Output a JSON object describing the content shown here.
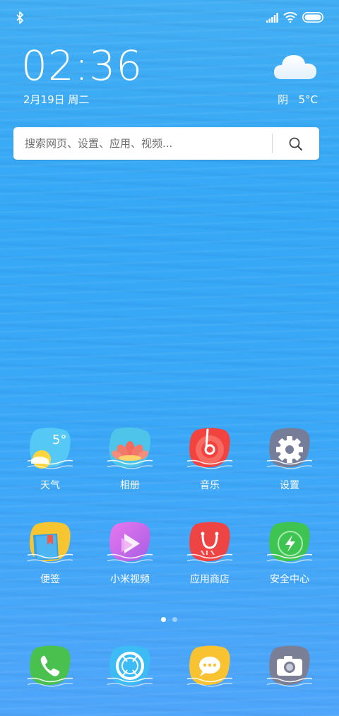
{
  "clock": {
    "time": "02:36",
    "date": "2月19日 周二"
  },
  "weather": {
    "condition": "阴",
    "temperature": "5°C",
    "icon": "cloud-icon"
  },
  "search": {
    "placeholder": "搜索网页、设置、应用、视频..."
  },
  "apps": [
    {
      "label": "天气",
      "icon": "weather-app-icon"
    },
    {
      "label": "相册",
      "icon": "gallery-app-icon"
    },
    {
      "label": "音乐",
      "icon": "music-app-icon"
    },
    {
      "label": "设置",
      "icon": "settings-app-icon"
    },
    {
      "label": "便签",
      "icon": "notes-app-icon"
    },
    {
      "label": "小米视频",
      "icon": "video-app-icon"
    },
    {
      "label": "应用商店",
      "icon": "app-store-icon"
    },
    {
      "label": "安全中心",
      "icon": "security-center-icon"
    }
  ],
  "weather_icon_temp": "5°",
  "dock": [
    {
      "icon": "phone-app-icon"
    },
    {
      "icon": "browser-app-icon"
    },
    {
      "icon": "messages-app-icon"
    },
    {
      "icon": "camera-app-icon"
    }
  ],
  "page_indicator": {
    "pages": 2,
    "current": 1
  },
  "colors": {
    "wallpaper": "#38a8f6",
    "weather": "#55c8f5",
    "gallery": "#4fc4ea",
    "music": "#f2433f",
    "settings": "#767d99",
    "notes": "#f7c530",
    "video": "#c76ee8",
    "store": "#ef4444",
    "security": "#3fc452",
    "phone": "#4ac04e",
    "browser": "#3dbbf4",
    "messages": "#f8c230",
    "camera": "#7a7f96"
  }
}
